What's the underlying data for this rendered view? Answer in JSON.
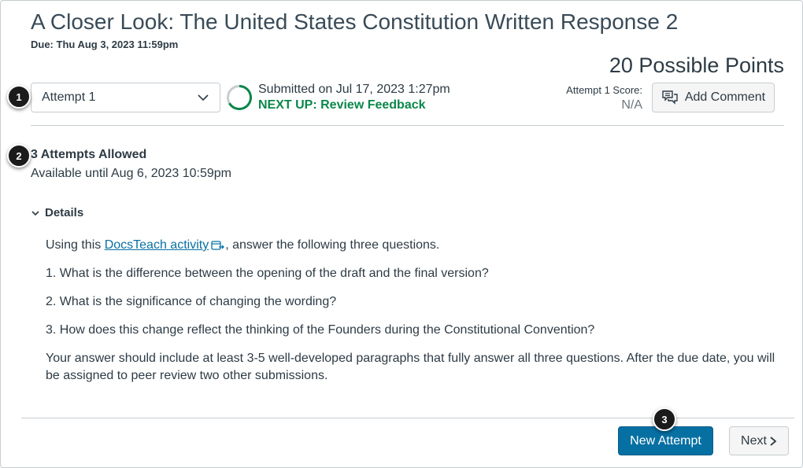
{
  "assignment": {
    "title": "A Closer Look: The United States Constitution Written Response 2",
    "due": "Due: Thu Aug 3, 2023 11:59pm",
    "points": "20 Possible Points"
  },
  "badges": [
    "1",
    "2",
    "3"
  ],
  "attempt": {
    "selected": "Attempt 1",
    "submitted": "Submitted on Jul 17, 2023 1:27pm",
    "next_up": "NEXT UP: Review Feedback",
    "score_label": "Attempt 1 Score:",
    "score_value": "N/A",
    "add_comment": "Add Comment"
  },
  "availability": {
    "allowed": "3 Attempts Allowed",
    "available": "Available until Aug 6, 2023 10:59pm"
  },
  "details": {
    "toggle_label": "Details",
    "intro_before": "Using this ",
    "link_text": "DocsTeach activity",
    "intro_after": ", answer the following three questions.",
    "q1": "1. What is the difference between the opening of the draft and the final version?",
    "q2": "2. What is the significance of changing the wording?",
    "q3": "3. How does this change reflect the thinking of the Founders during the Constitutional Convention?",
    "instructions": "Your answer should include at least 3-5 well-developed paragraphs that fully answer all three questions. After the due date, you will be assigned to peer review two other submissions."
  },
  "footer": {
    "new_attempt": "New Attempt",
    "next": "Next"
  },
  "colors": {
    "brand_blue": "#0770a3",
    "success_green": "#0b874b",
    "text": "#2d3b45"
  }
}
